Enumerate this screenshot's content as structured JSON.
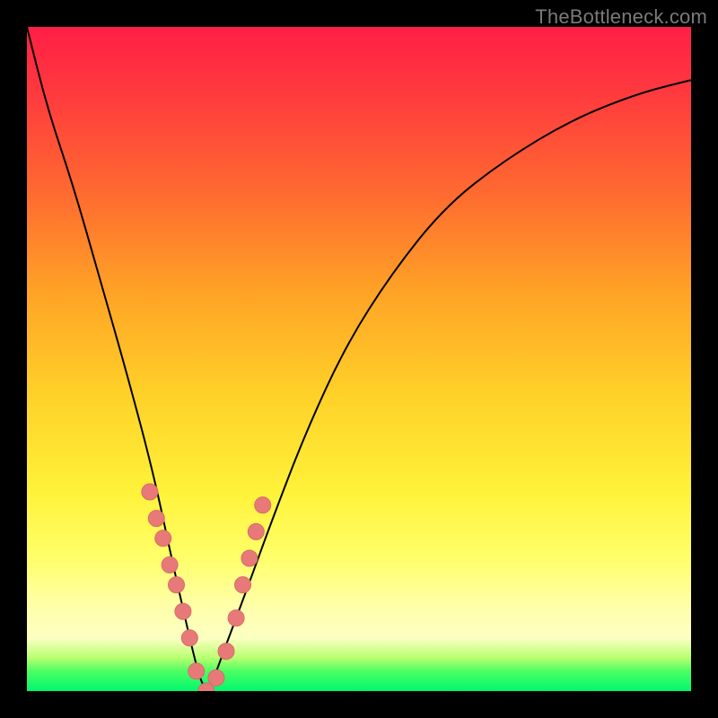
{
  "watermark": "TheBottleneck.com",
  "colors": {
    "curve_stroke": "#000000",
    "marker_fill": "#e77a78",
    "marker_stroke": "#d96a67"
  },
  "chart_data": {
    "type": "line",
    "title": "",
    "xlabel": "",
    "ylabel": "",
    "xlim": [
      0,
      1
    ],
    "ylim": [
      0,
      1
    ],
    "note": "Axes unlabeled; values are normalized fractions of the plot area. The curve is a V-shaped bottleneck profile with minimum near x≈0.27, y≈0.",
    "series": [
      {
        "name": "bottleneck-curve",
        "x": [
          0.0,
          0.03,
          0.07,
          0.11,
          0.15,
          0.19,
          0.22,
          0.245,
          0.26,
          0.27,
          0.278,
          0.3,
          0.33,
          0.37,
          0.42,
          0.48,
          0.55,
          0.63,
          0.72,
          0.82,
          0.92,
          1.0
        ],
        "y": [
          1.0,
          0.88,
          0.76,
          0.62,
          0.48,
          0.33,
          0.19,
          0.08,
          0.02,
          0.0,
          0.01,
          0.07,
          0.15,
          0.26,
          0.39,
          0.52,
          0.63,
          0.73,
          0.8,
          0.86,
          0.9,
          0.92
        ]
      }
    ],
    "markers": {
      "name": "highlight-points",
      "note": "Pink dots clustered near the curve minimum on both arms.",
      "x": [
        0.185,
        0.195,
        0.205,
        0.215,
        0.225,
        0.235,
        0.245,
        0.255,
        0.27,
        0.285,
        0.3,
        0.315,
        0.325,
        0.335,
        0.345,
        0.355
      ],
      "y": [
        0.3,
        0.26,
        0.23,
        0.19,
        0.16,
        0.12,
        0.08,
        0.03,
        0.0,
        0.02,
        0.06,
        0.11,
        0.16,
        0.2,
        0.24,
        0.28
      ]
    }
  }
}
